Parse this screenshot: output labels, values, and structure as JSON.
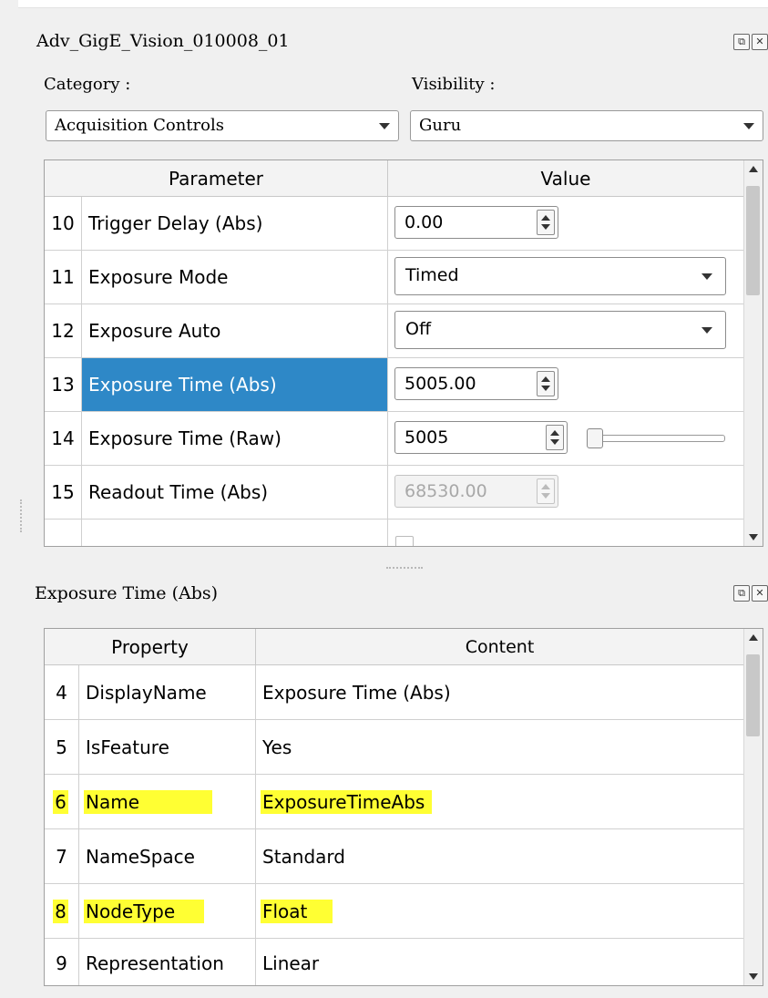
{
  "panel1": {
    "title": "Adv_GigE_Vision_010008_01",
    "category_label": "Category :",
    "category_value": "Acquisition Controls",
    "visibility_label": "Visibility :",
    "visibility_value": "Guru",
    "columns": [
      "Parameter",
      "Value"
    ],
    "rows": [
      {
        "num": "10",
        "name": "Trigger Delay (Abs)",
        "value": "0.00",
        "control": "spin"
      },
      {
        "num": "11",
        "name": "Exposure Mode",
        "value": "Timed",
        "control": "dropdown"
      },
      {
        "num": "12",
        "name": "Exposure Auto",
        "value": "Off",
        "control": "dropdown"
      },
      {
        "num": "13",
        "name": "Exposure Time (Abs)",
        "value": "5005.00",
        "control": "spin",
        "selected": true
      },
      {
        "num": "14",
        "name": "Exposure Time (Raw)",
        "value": "5005",
        "control": "spin+slider",
        "slider_fraction": 0.0
      },
      {
        "num": "15",
        "name": "Readout Time (Abs)",
        "value": "68530.00",
        "control": "spin",
        "disabled": true
      }
    ]
  },
  "panel2": {
    "title": "Exposure Time (Abs)",
    "columns": [
      "Property",
      "Content"
    ],
    "rows": [
      {
        "num": "4",
        "name": "DisplayName",
        "value": "Exposure Time (Abs)"
      },
      {
        "num": "5",
        "name": "IsFeature",
        "value": "Yes"
      },
      {
        "num": "6",
        "name": "Name",
        "value": "ExposureTimeAbs",
        "highlight": true
      },
      {
        "num": "7",
        "name": "NameSpace",
        "value": "Standard"
      },
      {
        "num": "8",
        "name": "NodeType",
        "value": "Float",
        "highlight": true
      },
      {
        "num": "9",
        "name": "Representation",
        "value": "Linear"
      }
    ]
  },
  "colors": {
    "selection": "#2e88c7",
    "highlight": "#ffff33"
  },
  "icons": [
    "float-icon",
    "close-icon",
    "chevron-down-icon",
    "spin-up-icon",
    "spin-down-icon",
    "scroll-up-icon",
    "scroll-down-icon"
  ]
}
